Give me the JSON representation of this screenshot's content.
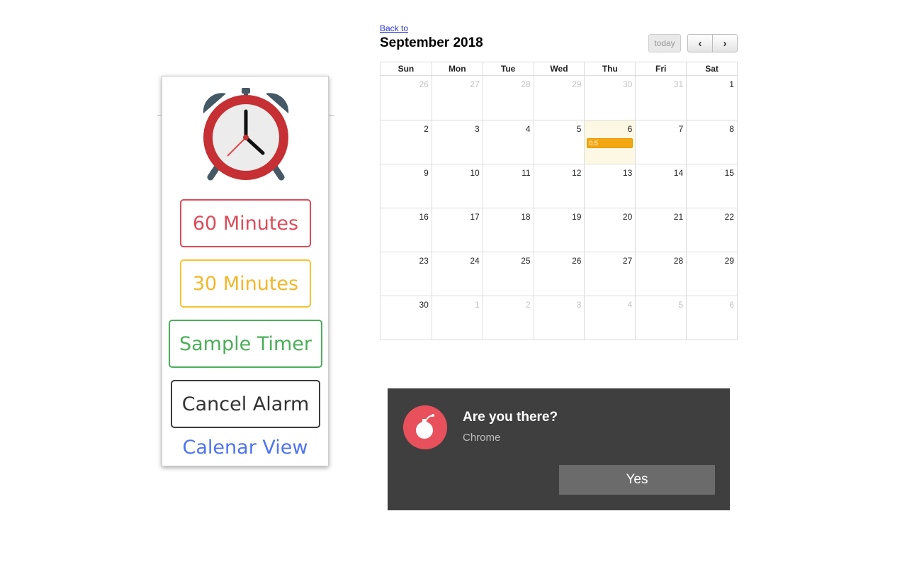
{
  "popup": {
    "buttons": {
      "sixty": "60 Minutes",
      "thirty": "30 Minutes",
      "sample": "Sample Timer",
      "cancel": "Cancel Alarm"
    },
    "calendar_link": "Calenar View",
    "icon": "alarm-clock-icon",
    "colors": {
      "red": "#dc4c5a",
      "yellow": "#f2b72a",
      "green": "#4cae5a",
      "link": "#4e73f0"
    }
  },
  "calendar": {
    "back_link": "Back to",
    "month_title": "September 2018",
    "today_label": "today",
    "prev_label": "‹",
    "next_label": "›",
    "weekdays": [
      "Sun",
      "Mon",
      "Tue",
      "Wed",
      "Thu",
      "Fri",
      "Sat"
    ],
    "days": [
      {
        "d": "26",
        "other": true
      },
      {
        "d": "27",
        "other": true
      },
      {
        "d": "28",
        "other": true
      },
      {
        "d": "29",
        "other": true
      },
      {
        "d": "30",
        "other": true
      },
      {
        "d": "31",
        "other": true
      },
      {
        "d": "1"
      },
      {
        "d": "2"
      },
      {
        "d": "3"
      },
      {
        "d": "4"
      },
      {
        "d": "5"
      },
      {
        "d": "6",
        "today": true,
        "event": "0.5"
      },
      {
        "d": "7"
      },
      {
        "d": "8"
      },
      {
        "d": "9"
      },
      {
        "d": "10"
      },
      {
        "d": "11"
      },
      {
        "d": "12"
      },
      {
        "d": "13"
      },
      {
        "d": "14"
      },
      {
        "d": "15"
      },
      {
        "d": "16"
      },
      {
        "d": "17"
      },
      {
        "d": "18"
      },
      {
        "d": "19"
      },
      {
        "d": "20"
      },
      {
        "d": "21"
      },
      {
        "d": "22"
      },
      {
        "d": "23"
      },
      {
        "d": "24"
      },
      {
        "d": "25"
      },
      {
        "d": "26"
      },
      {
        "d": "27"
      },
      {
        "d": "28"
      },
      {
        "d": "29"
      },
      {
        "d": "30"
      },
      {
        "d": "1",
        "other": true
      },
      {
        "d": "2",
        "other": true
      },
      {
        "d": "3",
        "other": true
      },
      {
        "d": "4",
        "other": true
      },
      {
        "d": "5",
        "other": true
      },
      {
        "d": "6",
        "other": true
      }
    ],
    "colors": {
      "today_bg": "#fcf8e3",
      "event": "#f3a712"
    }
  },
  "notification": {
    "title": "Are you there?",
    "source": "Chrome",
    "button": "Yes",
    "icon": "bomb-icon",
    "colors": {
      "bg": "#3f3f3f",
      "icon_bg": "#e8505b"
    }
  }
}
